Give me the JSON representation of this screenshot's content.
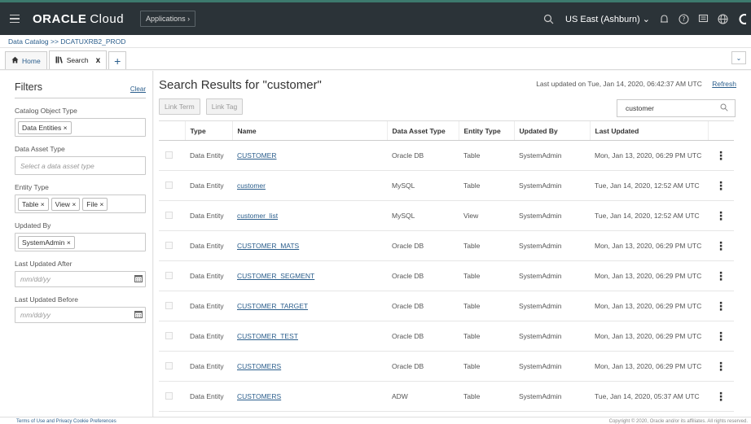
{
  "header": {
    "brand": "ORACLE",
    "brand_suffix": "Cloud",
    "applications_label": "Applications",
    "region": "US East (Ashburn)",
    "icons": [
      "menu-icon",
      "search-icon",
      "notification-icon",
      "help-icon",
      "chat-icon",
      "globe-icon",
      "profile-icon"
    ]
  },
  "breadcrumb": {
    "text": "Data Catalog >> DCATUXRB2_PROD"
  },
  "tabs": [
    {
      "label": "Home",
      "icon": "home-icon"
    },
    {
      "label": "Search",
      "icon": "library-icon",
      "close": "x"
    }
  ],
  "filters": {
    "title": "Filters",
    "clear_label": "Clear",
    "catalog_object_type": {
      "label": "Catalog Object Type",
      "chips": [
        "Data Entities"
      ]
    },
    "data_asset_type": {
      "label": "Data Asset Type",
      "placeholder": "Select a data asset type"
    },
    "entity_type": {
      "label": "Entity Type",
      "chips": [
        "Table",
        "View",
        "File"
      ]
    },
    "updated_by": {
      "label": "Updated By",
      "chips": [
        "SystemAdmin"
      ]
    },
    "last_updated_after": {
      "label": "Last Updated After",
      "placeholder": "mm/dd/yy"
    },
    "last_updated_before": {
      "label": "Last Updated Before",
      "placeholder": "mm/dd/yy"
    }
  },
  "results": {
    "title": "Search Results for \"customer\"",
    "last_updated": "Last updated on Tue, Jan 14, 2020, 06:42:37 AM UTC",
    "refresh_label": "Refresh",
    "link_term_label": "Link Term",
    "link_tag_label": "Link Tag",
    "search_value": "customer",
    "columns": [
      "Type",
      "Name",
      "Data Asset Type",
      "Entity Type",
      "Updated By",
      "Last Updated"
    ],
    "rows": [
      {
        "type": "Data Entity",
        "name": "CUSTOMER",
        "asset": "Oracle DB",
        "entity": "Table",
        "by": "SystemAdmin",
        "updated": "Mon, Jan 13, 2020, 06:29 PM UTC"
      },
      {
        "type": "Data Entity",
        "name": "customer",
        "asset": "MySQL",
        "entity": "Table",
        "by": "SystemAdmin",
        "updated": "Tue, Jan 14, 2020, 12:52 AM UTC"
      },
      {
        "type": "Data Entity",
        "name": "customer_list",
        "asset": "MySQL",
        "entity": "View",
        "by": "SystemAdmin",
        "updated": "Tue, Jan 14, 2020, 12:52 AM UTC"
      },
      {
        "type": "Data Entity",
        "name": "CUSTOMER_MATS",
        "asset": "Oracle DB",
        "entity": "Table",
        "by": "SystemAdmin",
        "updated": "Mon, Jan 13, 2020, 06:29 PM UTC"
      },
      {
        "type": "Data Entity",
        "name": "CUSTOMER_SEGMENT",
        "asset": "Oracle DB",
        "entity": "Table",
        "by": "SystemAdmin",
        "updated": "Mon, Jan 13, 2020, 06:29 PM UTC"
      },
      {
        "type": "Data Entity",
        "name": "CUSTOMER_TARGET",
        "asset": "Oracle DB",
        "entity": "Table",
        "by": "SystemAdmin",
        "updated": "Mon, Jan 13, 2020, 06:29 PM UTC"
      },
      {
        "type": "Data Entity",
        "name": "CUSTOMER_TEST",
        "asset": "Oracle DB",
        "entity": "Table",
        "by": "SystemAdmin",
        "updated": "Mon, Jan 13, 2020, 06:29 PM UTC"
      },
      {
        "type": "Data Entity",
        "name": "CUSTOMERS",
        "asset": "Oracle DB",
        "entity": "Table",
        "by": "SystemAdmin",
        "updated": "Mon, Jan 13, 2020, 06:29 PM UTC"
      },
      {
        "type": "Data Entity",
        "name": "CUSTOMERS",
        "asset": "ADW",
        "entity": "Table",
        "by": "SystemAdmin",
        "updated": "Tue, Jan 14, 2020, 05:37 AM UTC"
      }
    ]
  },
  "footer": {
    "left": "Terms of Use and Privacy    Cookie Preferences",
    "right": "Copyright © 2020, Oracle and/or its affiliates. All rights reserved."
  },
  "colors": {
    "header_bg": "#2b3338",
    "link": "#2b5e8c",
    "accent": "#3d7a6e"
  }
}
